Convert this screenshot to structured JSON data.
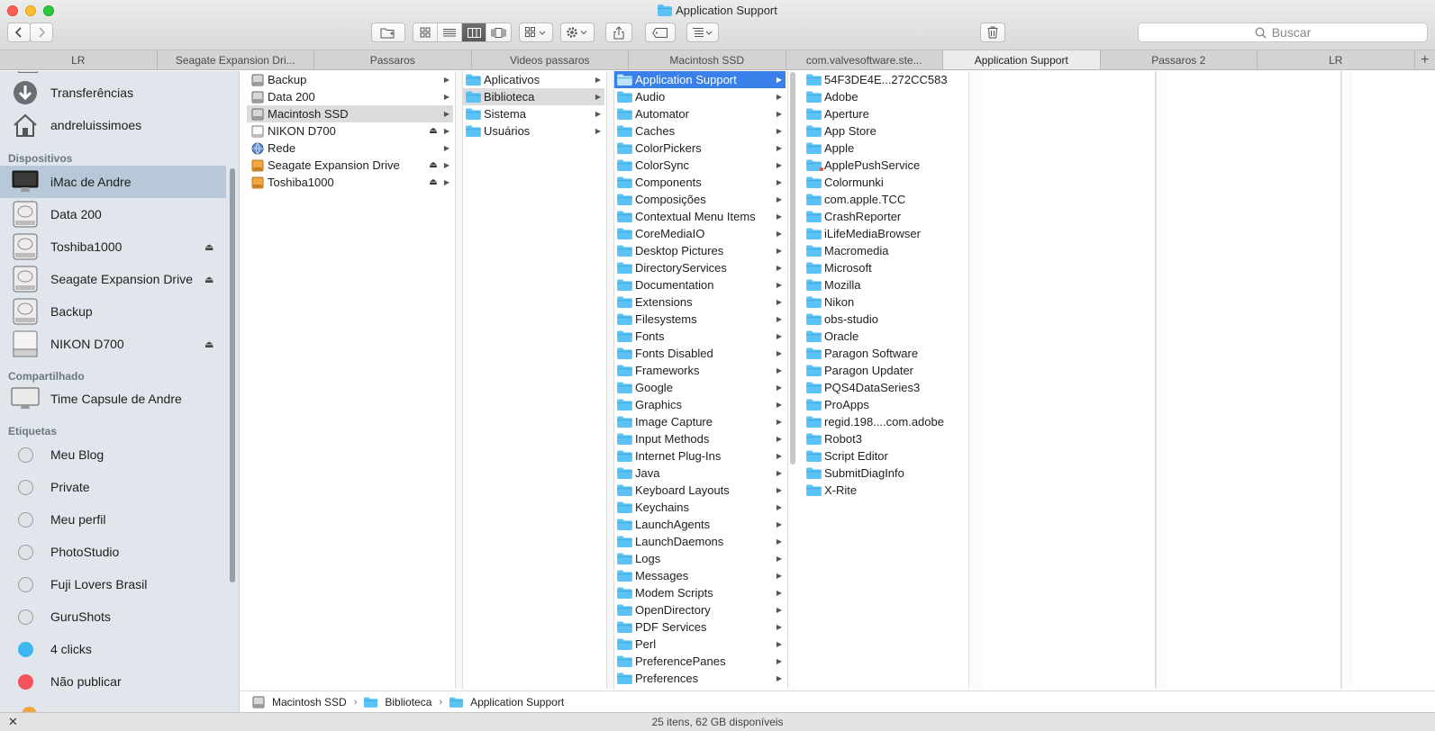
{
  "window": {
    "title": "Application Support"
  },
  "toolbar": {
    "search_placeholder": "Buscar"
  },
  "tabs": [
    "LR",
    "Seagate Expansion Dri...",
    "Passaros",
    "Videos passaros",
    "Macintosh SSD",
    "com.valvesoftware.ste...",
    "Application Support",
    "Passaros 2",
    "LR"
  ],
  "active_tab": 6,
  "sidebar": {
    "favorites": [
      {
        "label": "Transferências",
        "icon": "download-icon"
      },
      {
        "label": "andreluissimoes",
        "icon": "home-icon"
      }
    ],
    "devices_header": "Dispositivos",
    "devices": [
      {
        "label": "iMac de Andre",
        "icon": "imac-icon",
        "eject": false,
        "selected": true
      },
      {
        "label": "Data 200",
        "icon": "disk-icon",
        "eject": false
      },
      {
        "label": "Toshiba1000",
        "icon": "disk-icon",
        "eject": true
      },
      {
        "label": "Seagate Expansion Drive",
        "icon": "disk-icon",
        "eject": true
      },
      {
        "label": "Backup",
        "icon": "disk-icon",
        "eject": false
      },
      {
        "label": "NIKON D700",
        "icon": "flat-disk-icon",
        "eject": true
      }
    ],
    "shared_header": "Compartilhado",
    "shared": [
      {
        "label": "Time Capsule de Andre",
        "icon": "display-icon"
      }
    ],
    "tags_header": "Etiquetas",
    "tags": [
      {
        "label": "Meu Blog",
        "color": ""
      },
      {
        "label": "Private",
        "color": ""
      },
      {
        "label": "Meu perfil",
        "color": ""
      },
      {
        "label": "PhotoStudio",
        "color": ""
      },
      {
        "label": "Fuji Lovers Brasil",
        "color": ""
      },
      {
        "label": "GuruShots",
        "color": ""
      },
      {
        "label": "4 clicks",
        "color": "#3fb6f0"
      },
      {
        "label": "Não publicar",
        "color": "#f4535c"
      }
    ]
  },
  "columns": {
    "col1": [
      {
        "label": "Backup",
        "icon": "disk",
        "eject": false,
        "arrow": true
      },
      {
        "label": "Data 200",
        "icon": "disk",
        "eject": false,
        "arrow": true
      },
      {
        "label": "Macintosh SSD",
        "icon": "disk",
        "eject": false,
        "arrow": true,
        "state": "hl"
      },
      {
        "label": "NIKON D700",
        "icon": "flat",
        "eject": true,
        "arrow": true
      },
      {
        "label": "Rede",
        "icon": "globe",
        "eject": false,
        "arrow": true
      },
      {
        "label": "Seagate Expansion Drive",
        "icon": "orange",
        "eject": true,
        "arrow": true
      },
      {
        "label": "Toshiba1000",
        "icon": "orange",
        "eject": true,
        "arrow": true
      }
    ],
    "col2": [
      {
        "label": "Aplicativos",
        "icon": "folder",
        "arrow": true
      },
      {
        "label": "Biblioteca",
        "icon": "folder",
        "arrow": true,
        "state": "hl"
      },
      {
        "label": "Sistema",
        "icon": "folder",
        "arrow": true
      },
      {
        "label": "Usuários",
        "icon": "folder",
        "arrow": true
      }
    ],
    "col3": [
      {
        "label": "Application Support",
        "state": "active"
      },
      {
        "label": "Audio"
      },
      {
        "label": "Automator"
      },
      {
        "label": "Caches"
      },
      {
        "label": "ColorPickers"
      },
      {
        "label": "ColorSync"
      },
      {
        "label": "Components"
      },
      {
        "label": "Composições"
      },
      {
        "label": "Contextual Menu Items"
      },
      {
        "label": "CoreMediaIO"
      },
      {
        "label": "Desktop Pictures"
      },
      {
        "label": "DirectoryServices"
      },
      {
        "label": "Documentation"
      },
      {
        "label": "Extensions"
      },
      {
        "label": "Filesystems"
      },
      {
        "label": "Fonts"
      },
      {
        "label": "Fonts Disabled"
      },
      {
        "label": "Frameworks"
      },
      {
        "label": "Google"
      },
      {
        "label": "Graphics"
      },
      {
        "label": "Image Capture"
      },
      {
        "label": "Input Methods"
      },
      {
        "label": "Internet Plug-Ins"
      },
      {
        "label": "Java"
      },
      {
        "label": "Keyboard Layouts"
      },
      {
        "label": "Keychains"
      },
      {
        "label": "LaunchAgents"
      },
      {
        "label": "LaunchDaemons"
      },
      {
        "label": "Logs"
      },
      {
        "label": "Messages"
      },
      {
        "label": "Modem Scripts"
      },
      {
        "label": "OpenDirectory"
      },
      {
        "label": "PDF Services"
      },
      {
        "label": "Perl"
      },
      {
        "label": "PreferencePanes"
      },
      {
        "label": "Preferences"
      }
    ],
    "col4": [
      {
        "label": "54F3DE4E...272CC583",
        "arrow": true
      },
      {
        "label": "Adobe",
        "arrow": true
      },
      {
        "label": "Aperture",
        "arrow": true
      },
      {
        "label": "App Store",
        "arrow": true
      },
      {
        "label": "Apple",
        "arrow": true
      },
      {
        "label": "ApplePushService",
        "arrow": false,
        "badge": true
      },
      {
        "label": "Colormunki",
        "arrow": true
      },
      {
        "label": "com.apple.TCC",
        "arrow": true
      },
      {
        "label": "CrashReporter",
        "arrow": true
      },
      {
        "label": "iLifeMediaBrowser",
        "arrow": true
      },
      {
        "label": "Macromedia",
        "arrow": true
      },
      {
        "label": "Microsoft",
        "arrow": true
      },
      {
        "label": "Mozilla",
        "arrow": true
      },
      {
        "label": "Nikon",
        "arrow": true
      },
      {
        "label": "obs-studio",
        "arrow": true
      },
      {
        "label": "Oracle",
        "arrow": true
      },
      {
        "label": "Paragon Software",
        "arrow": true
      },
      {
        "label": "Paragon Updater",
        "arrow": true
      },
      {
        "label": "PQS4DataSeries3",
        "arrow": true
      },
      {
        "label": "ProApps",
        "arrow": true
      },
      {
        "label": "regid.198....com.adobe",
        "arrow": true
      },
      {
        "label": "Robot3",
        "arrow": true
      },
      {
        "label": "Script Editor",
        "arrow": true
      },
      {
        "label": "SubmitDiagInfo",
        "arrow": true
      },
      {
        "label": "X-Rite",
        "arrow": true
      }
    ]
  },
  "pathbar": [
    "Macintosh SSD",
    "Biblioteca",
    "Application Support"
  ],
  "status": {
    "text": "25 itens, 62 GB disponíveis"
  },
  "colors": {
    "selection": "#3a80ea",
    "folder": "#5ac2f4",
    "sidebar_bg": "#e0e6ec"
  }
}
